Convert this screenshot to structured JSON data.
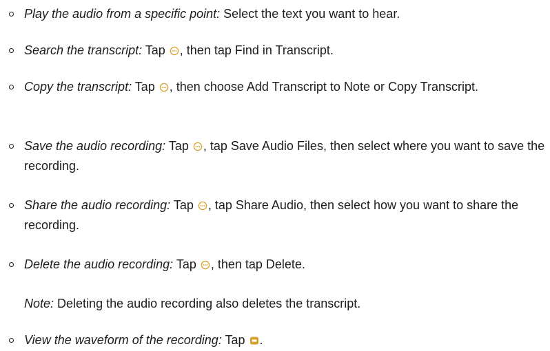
{
  "items": [
    {
      "term": "Play the audio from a specific point:",
      "parts": [
        " Select the text you want to hear."
      ]
    },
    {
      "term": "Search the transcript:",
      "parts": [
        " Tap ",
        ", then tap Find in Transcript."
      ],
      "icon": "more-icon"
    },
    {
      "term": "Copy the transcript:",
      "parts": [
        " Tap ",
        ", then choose Add Transcript to Note or Copy Transcript."
      ],
      "icon": "more-icon"
    },
    {
      "term": "Save the audio recording:",
      "parts": [
        " Tap ",
        ", tap Save Audio Files, then select where you want to save the recording."
      ],
      "icon": "more-icon"
    },
    {
      "term": "Share the audio recording:",
      "parts": [
        " Tap ",
        ", tap Share Audio, then select how you want to share the recording."
      ],
      "icon": "more-icon"
    },
    {
      "term": "Delete the audio recording:",
      "parts": [
        " Tap ",
        ", then tap Delete."
      ],
      "icon": "more-icon"
    },
    {
      "term": "View the waveform of the recording:",
      "parts": [
        " Tap ",
        "."
      ],
      "icon": "waveform-icon"
    }
  ],
  "note": {
    "label": "Note:",
    "text": " Deleting the audio recording also deletes the transcript."
  },
  "colors": {
    "icon_accent": "#d8a02a",
    "text": "#1d1d1f"
  }
}
